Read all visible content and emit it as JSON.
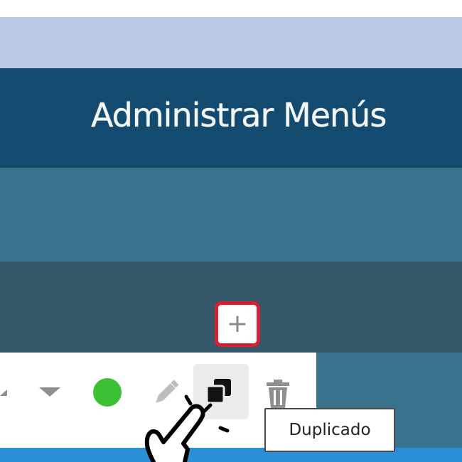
{
  "header": {
    "title": "Administrar Menús"
  },
  "toolbar": {
    "add_button_label": "+",
    "duplicate_tooltip": "Duplicado",
    "status_color": "#3ec034"
  },
  "icons": {
    "up": "caret-up-icon",
    "down": "caret-down-icon",
    "status": "status-dot",
    "edit": "pencil-icon",
    "duplicate": "duplicate-icon",
    "delete": "trash-icon",
    "pointer": "hand-cursor-icon"
  },
  "colors": {
    "title_bar": "#134a6f",
    "light_band": "#b9c9e6",
    "teal_band": "#3a718d",
    "slate_band": "#365669",
    "accent_border": "#d8202f",
    "bottom_blue": "#2b8fd8"
  }
}
